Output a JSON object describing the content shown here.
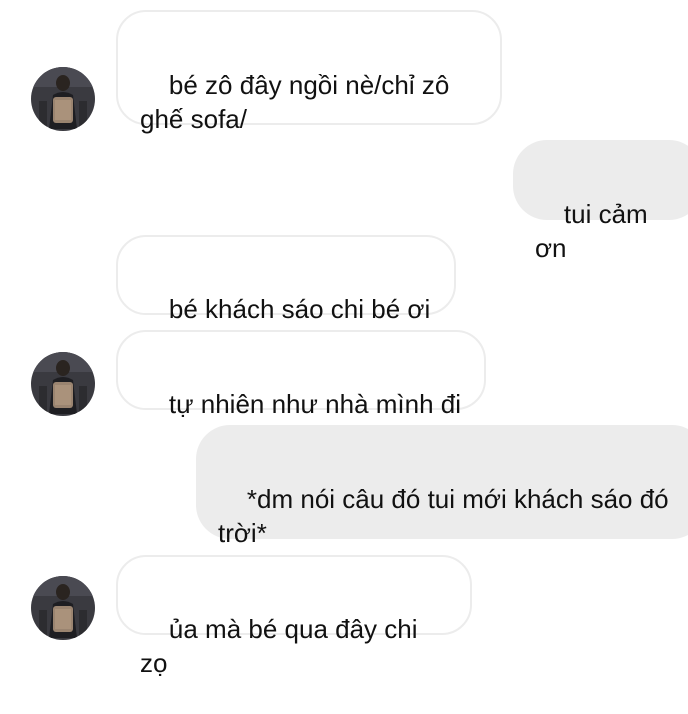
{
  "messages": [
    {
      "sender": "them",
      "text": "bé zô đây ngồi nè/chỉ zô ghế sofa/"
    },
    {
      "sender": "me",
      "text": "tui cảm ơn"
    },
    {
      "sender": "them",
      "text": "bé khách sáo chi bé ơi"
    },
    {
      "sender": "them",
      "text": "tự nhiên như nhà mình đi"
    },
    {
      "sender": "me",
      "text": "*dm nói câu đó tui mới khách sáo đó trời*"
    },
    {
      "sender": "them",
      "text": "ủa mà bé qua đây chi zọ"
    }
  ],
  "avatar": {
    "icon": "person-photo-icon"
  },
  "colors": {
    "outgoing_bubble": "#ececec",
    "incoming_border": "#ececec",
    "text": "#111111",
    "background": "#ffffff"
  }
}
